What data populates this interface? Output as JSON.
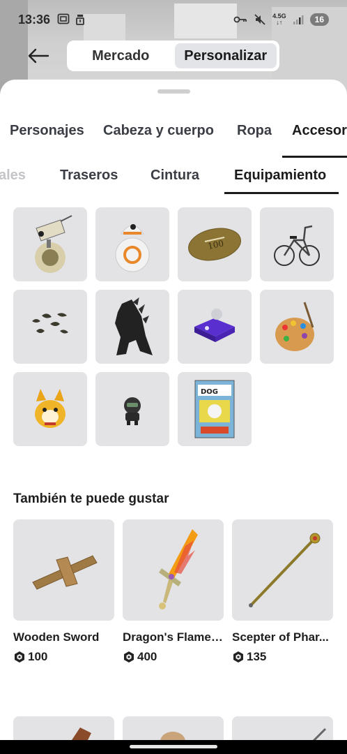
{
  "status_bar": {
    "time": "13:36",
    "network_top": "4.5G",
    "battery": "16",
    "icons": [
      "screenshot-icon",
      "alarm-icon",
      "key-icon",
      "mute-icon",
      "signal-icon",
      "battery-icon"
    ]
  },
  "header": {
    "back_icon": "arrow-left-icon",
    "tabs": [
      {
        "label": "Mercado",
        "active": false
      },
      {
        "label": "Personalizar",
        "active": true
      }
    ]
  },
  "category_tabs": [
    {
      "label": "Personajes",
      "active": false
    },
    {
      "label": "Cabeza y cuerpo",
      "active": false
    },
    {
      "label": "Ropa",
      "active": false
    },
    {
      "label": "Accesorios",
      "active": true
    }
  ],
  "sub_tabs": [
    {
      "label": "ales",
      "active": false
    },
    {
      "label": "Traseros",
      "active": false
    },
    {
      "label": "Cintura",
      "active": false
    },
    {
      "label": "Equipamiento",
      "active": true
    }
  ],
  "owned_items": [
    {
      "name": "d-o-droid"
    },
    {
      "name": "bb8-droid"
    },
    {
      "name": "football"
    },
    {
      "name": "bicycle"
    },
    {
      "name": "bats-swarm"
    },
    {
      "name": "godzilla"
    },
    {
      "name": "purple-device"
    },
    {
      "name": "paint-palette"
    },
    {
      "name": "corgi-pet"
    },
    {
      "name": "dark-robot"
    },
    {
      "name": "dog-man-book"
    }
  ],
  "recommendations": {
    "title": "También te puede gustar",
    "currency_icon": "robux-icon",
    "items": [
      {
        "name": "Wooden Sword",
        "price": "100"
      },
      {
        "name": "Dragon's Flame ...",
        "price": "400"
      },
      {
        "name": "Scepter of Phar...",
        "price": "135"
      }
    ]
  },
  "colors": {
    "accent_underline": "#1a1a1a",
    "tile_bg": "#e3e3e6",
    "sheet_bg": "#ffffff"
  }
}
